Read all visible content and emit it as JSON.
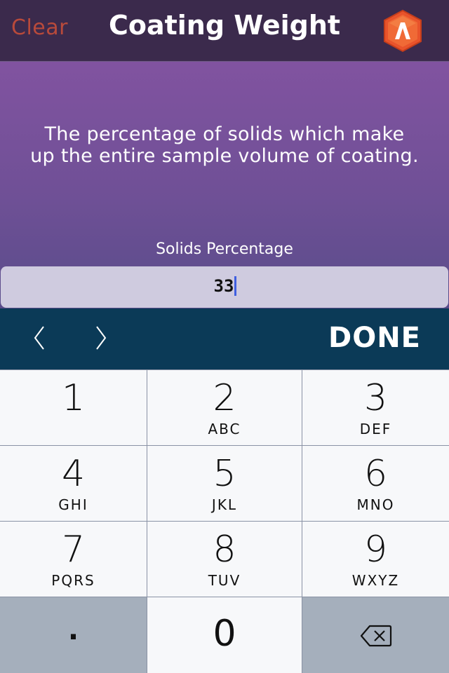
{
  "header": {
    "clear_label": "Clear",
    "title": "Coating Weight",
    "logo_icon": "app-logo-icon",
    "clear_color": "#b84a3b"
  },
  "main": {
    "description_line1": "The percentage of solids which make",
    "description_line2": "up the entire sample volume of coating.",
    "field_label": "Solids Percentage",
    "field_value": "33"
  },
  "toolbar": {
    "prev_icon": "chevron-left-icon",
    "next_icon": "chevron-right-icon",
    "done_label": "DONE"
  },
  "keypad": {
    "keys": [
      {
        "num": "1",
        "letters": ""
      },
      {
        "num": "2",
        "letters": "ABC"
      },
      {
        "num": "3",
        "letters": "DEF"
      },
      {
        "num": "4",
        "letters": "GHI"
      },
      {
        "num": "5",
        "letters": "JKL"
      },
      {
        "num": "6",
        "letters": "MNO"
      },
      {
        "num": "7",
        "letters": "PQRS"
      },
      {
        "num": "8",
        "letters": "TUV"
      },
      {
        "num": "9",
        "letters": "WXYZ"
      }
    ],
    "dot_label": ".",
    "zero_label": "0",
    "delete_icon": "backspace-icon"
  }
}
